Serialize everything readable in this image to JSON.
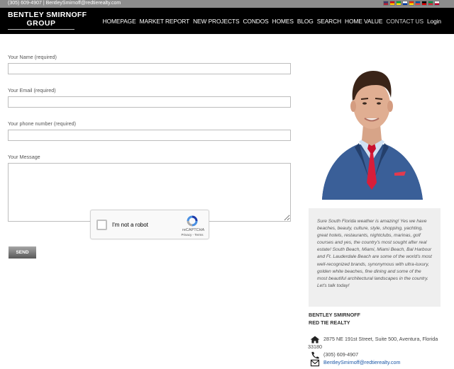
{
  "topbar": {
    "contact_line": "(305) 609-4907 | BentleySmirnoff@redtierealty.com",
    "flags": [
      {
        "name": "flag-us",
        "c1": "#3c3b6e",
        "c2": "#b22234"
      },
      {
        "name": "flag-es",
        "c1": "#c60b1e",
        "c2": "#ffc400"
      },
      {
        "name": "flag-br",
        "c1": "#009c3b",
        "c2": "#ffdf00"
      },
      {
        "name": "flag-ru",
        "c1": "#ffffff",
        "c2": "#0039a6"
      },
      {
        "name": "flag-cn",
        "c1": "#de2910",
        "c2": "#ffde00"
      },
      {
        "name": "flag-fr",
        "c1": "#0055a4",
        "c2": "#ef4135"
      },
      {
        "name": "flag-de",
        "c1": "#000000",
        "c2": "#dd0000"
      },
      {
        "name": "flag-it",
        "c1": "#009246",
        "c2": "#ce2b37"
      },
      {
        "name": "flag-jp",
        "c1": "#ffffff",
        "c2": "#bc002d"
      }
    ]
  },
  "header": {
    "logo_line1": "BENTLEY SMIRNOFF",
    "logo_line2": "GROUP",
    "nav": [
      "HOMEPAGE",
      "MARKET REPORT",
      "NEW PROJECTS",
      "CONDOS",
      "HOMES",
      "BLOG",
      "SEARCH",
      "HOME VALUE",
      "CONTACT US",
      "Login"
    ],
    "active_index": 8
  },
  "form": {
    "name_label": "Your Name (required)",
    "email_label": "Your Email (required)",
    "phone_label": "Your phone number (required)",
    "message_label": "Your Message",
    "name_value": "",
    "email_value": "",
    "phone_value": "",
    "message_value": "",
    "send_label": "SEND"
  },
  "captcha": {
    "label": "I'm not a robot",
    "brand": "reCAPTCHA",
    "terms": "Privacy - Terms"
  },
  "sidebar": {
    "quote": "Sure South Florida weather is amazing! Yes we have beaches, beauty, culture, style, shopping, yachting, great hotels, restaurants, nightclubs, marinas, golf courses and yes, the country's most sought after real estate! South Beach, Miami, Miami Beach, Bal Harbour and Ft. Lauderdale Beach are some of the world's most well-recognized brands, synonymous with ultra-luxury, golden white beaches, fine dining and some of the most beautiful architectural landscapes in the country. Let's talk today!",
    "agent_name": "BENTLEY SMIRNOFF",
    "agency": "RED TIE REALTY",
    "address_line1": "2875 NE 191st Street, Suite 500, Aventura, Florida",
    "address_line2": "33180",
    "phone": "(305) 609-4907",
    "email": "BentleySmirnoff@redtierealty.com"
  },
  "colors": {
    "topbar": "#8c8c8c",
    "header": "#000000",
    "link": "#1a56a6",
    "quote_bg": "#efefef"
  }
}
